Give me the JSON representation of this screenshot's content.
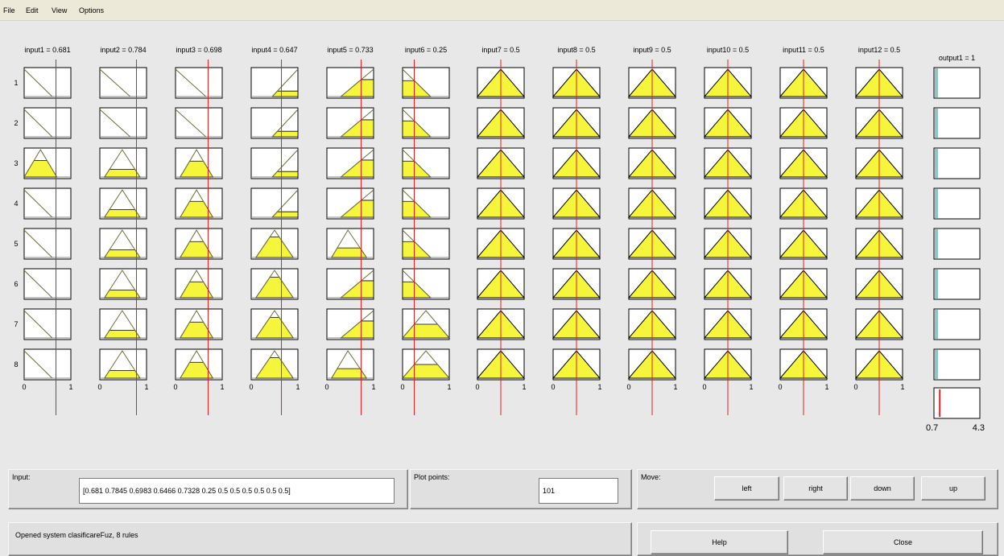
{
  "menu": [
    {
      "id": "file",
      "label": "File"
    },
    {
      "id": "edit",
      "label": "Edit"
    },
    {
      "id": "view",
      "label": "View"
    },
    {
      "id": "options",
      "label": "Options"
    }
  ],
  "viewer": {
    "rule_count": 8,
    "rule_numbers": [
      "1",
      "2",
      "3",
      "4",
      "5",
      "6",
      "7",
      "8"
    ],
    "axis_min_label": "0",
    "axis_max_label": "1",
    "colors": {
      "fill": "#f5f53c",
      "line": "#e41e1e",
      "mf_stroke": "#6d6d3a",
      "output_bar": "#8fc7c7"
    },
    "inputs": [
      {
        "title": "input1 = 0.681",
        "value": 0.681,
        "rules": [
          {
            "type": "zfall",
            "a": 0,
            "b": 0.6,
            "level": 0
          },
          {
            "type": "zfall",
            "a": 0,
            "b": 0.6,
            "level": 0
          },
          {
            "type": "tri",
            "a": 0,
            "b": 0.35,
            "c": 0.7,
            "level": 0.6
          },
          {
            "type": "zfall",
            "a": 0,
            "b": 0.6,
            "level": 0
          },
          {
            "type": "zfall",
            "a": 0,
            "b": 0.6,
            "level": 0
          },
          {
            "type": "zfall",
            "a": 0,
            "b": 0.6,
            "level": 0
          },
          {
            "type": "zfall",
            "a": 0,
            "b": 0.6,
            "level": 0
          },
          {
            "type": "zfall",
            "a": 0,
            "b": 0.6,
            "level": 0
          }
        ]
      },
      {
        "title": "input2 = 0.784",
        "value": 0.784,
        "rules": [
          {
            "type": "zfall",
            "a": 0,
            "b": 0.65,
            "level": 0
          },
          {
            "type": "zfall",
            "a": 0,
            "b": 0.65,
            "level": 0
          },
          {
            "type": "tri",
            "a": 0.1,
            "b": 0.48,
            "c": 0.86,
            "level": 0.28
          },
          {
            "type": "tri",
            "a": 0.1,
            "b": 0.48,
            "c": 0.86,
            "level": 0.28
          },
          {
            "type": "tri",
            "a": 0.1,
            "b": 0.48,
            "c": 0.86,
            "level": 0.28
          },
          {
            "type": "tri",
            "a": 0.1,
            "b": 0.48,
            "c": 0.86,
            "level": 0.28
          },
          {
            "type": "tri",
            "a": 0.1,
            "b": 0.48,
            "c": 0.86,
            "level": 0.28
          },
          {
            "type": "tri",
            "a": 0.1,
            "b": 0.48,
            "c": 0.86,
            "level": 0.28
          }
        ]
      },
      {
        "title": "input3 = 0.698",
        "value": 0.698,
        "rules": [
          {
            "type": "zfall",
            "a": 0,
            "b": 0.65,
            "level": 0
          },
          {
            "type": "zfall",
            "a": 0,
            "b": 0.65,
            "level": 0
          },
          {
            "type": "tri",
            "a": 0.1,
            "b": 0.45,
            "c": 0.8,
            "level": 0.58
          },
          {
            "type": "tri",
            "a": 0.1,
            "b": 0.45,
            "c": 0.8,
            "level": 0.58
          },
          {
            "type": "tri",
            "a": 0.1,
            "b": 0.45,
            "c": 0.8,
            "level": 0.58
          },
          {
            "type": "tri",
            "a": 0.1,
            "b": 0.45,
            "c": 0.8,
            "level": 0.58
          },
          {
            "type": "tri",
            "a": 0.1,
            "b": 0.45,
            "c": 0.8,
            "level": 0.58
          },
          {
            "type": "tri",
            "a": 0.1,
            "b": 0.45,
            "c": 0.8,
            "level": 0.58
          }
        ]
      },
      {
        "title": "input4 = 0.647",
        "value": 0.647,
        "rules": [
          {
            "type": "srise",
            "a": 0.45,
            "b": 1,
            "level": 0.2
          },
          {
            "type": "srise",
            "a": 0.45,
            "b": 1,
            "level": 0.2
          },
          {
            "type": "srise",
            "a": 0.45,
            "b": 1,
            "level": 0.2
          },
          {
            "type": "srise",
            "a": 0.45,
            "b": 1,
            "level": 0.2
          },
          {
            "type": "tri",
            "a": 0.1,
            "b": 0.5,
            "c": 0.9,
            "level": 0.75
          },
          {
            "type": "tri",
            "a": 0.1,
            "b": 0.5,
            "c": 0.9,
            "level": 0.75
          },
          {
            "type": "tri",
            "a": 0.1,
            "b": 0.5,
            "c": 0.9,
            "level": 0.75
          },
          {
            "type": "tri",
            "a": 0.1,
            "b": 0.5,
            "c": 0.9,
            "level": 0.75
          }
        ]
      },
      {
        "title": "input5 = 0.733",
        "value": 0.733,
        "rules": [
          {
            "type": "srise",
            "a": 0.3,
            "b": 1,
            "level": 0.62
          },
          {
            "type": "srise",
            "a": 0.3,
            "b": 1,
            "level": 0.62
          },
          {
            "type": "srise",
            "a": 0.3,
            "b": 1,
            "level": 0.62
          },
          {
            "type": "srise",
            "a": 0.3,
            "b": 1,
            "level": 0.62
          },
          {
            "type": "tri",
            "a": 0.1,
            "b": 0.45,
            "c": 0.85,
            "level": 0.35
          },
          {
            "type": "srise",
            "a": 0.3,
            "b": 1,
            "level": 0.62
          },
          {
            "type": "srise",
            "a": 0.3,
            "b": 1,
            "level": 0.62
          },
          {
            "type": "tri",
            "a": 0.1,
            "b": 0.45,
            "c": 0.85,
            "level": 0.35
          }
        ]
      },
      {
        "title": "input6 = 0.25",
        "value": 0.25,
        "rules": [
          {
            "type": "zfall",
            "a": 0,
            "b": 0.6,
            "level": 0.58
          },
          {
            "type": "zfall",
            "a": 0,
            "b": 0.6,
            "level": 0.58
          },
          {
            "type": "zfall",
            "a": 0,
            "b": 0.6,
            "level": 0.58
          },
          {
            "type": "zfall",
            "a": 0,
            "b": 0.6,
            "level": 0.58
          },
          {
            "type": "zfall",
            "a": 0,
            "b": 0.6,
            "level": 0.58
          },
          {
            "type": "zfall",
            "a": 0,
            "b": 0.6,
            "level": 0.58
          },
          {
            "type": "tri",
            "a": 0,
            "b": 0.5,
            "c": 1,
            "level": 0.5
          },
          {
            "type": "tri",
            "a": 0,
            "b": 0.5,
            "c": 1,
            "level": 0.5
          }
        ]
      },
      {
        "title": "input7 = 0.5",
        "value": 0.5,
        "rules": "tri-full"
      },
      {
        "title": "input8 = 0.5",
        "value": 0.5,
        "rules": "tri-full"
      },
      {
        "title": "input9 = 0.5",
        "value": 0.5,
        "rules": "tri-full"
      },
      {
        "title": "input10 = 0.5",
        "value": 0.5,
        "rules": "tri-full"
      },
      {
        "title": "input11 = 0.5",
        "value": 0.5,
        "rules": "tri-full"
      },
      {
        "title": "input12 = 0.5",
        "value": 0.5,
        "rules": "tri-full"
      }
    ],
    "output": {
      "title": "output1 = 1",
      "value": 1,
      "range_min_label": "0.7",
      "range_max_label": "4.3",
      "range": [
        0.7,
        4.3
      ],
      "bar_fraction": 0.12
    }
  },
  "controls": {
    "input_label": "Input:",
    "input_value": "[0.681 0.7845 0.6983 0.6466 0.7328 0.25 0.5 0.5 0.5 0.5 0.5 0.5]",
    "plot_points_label": "Plot points:",
    "plot_points_value": "101",
    "move_label": "Move:",
    "left_label": "left",
    "right_label": "right",
    "down_label": "down",
    "up_label": "up",
    "status_text": "Opened system clasificareFuz, 8 rules",
    "help_label": "Help",
    "close_label": "Close"
  }
}
